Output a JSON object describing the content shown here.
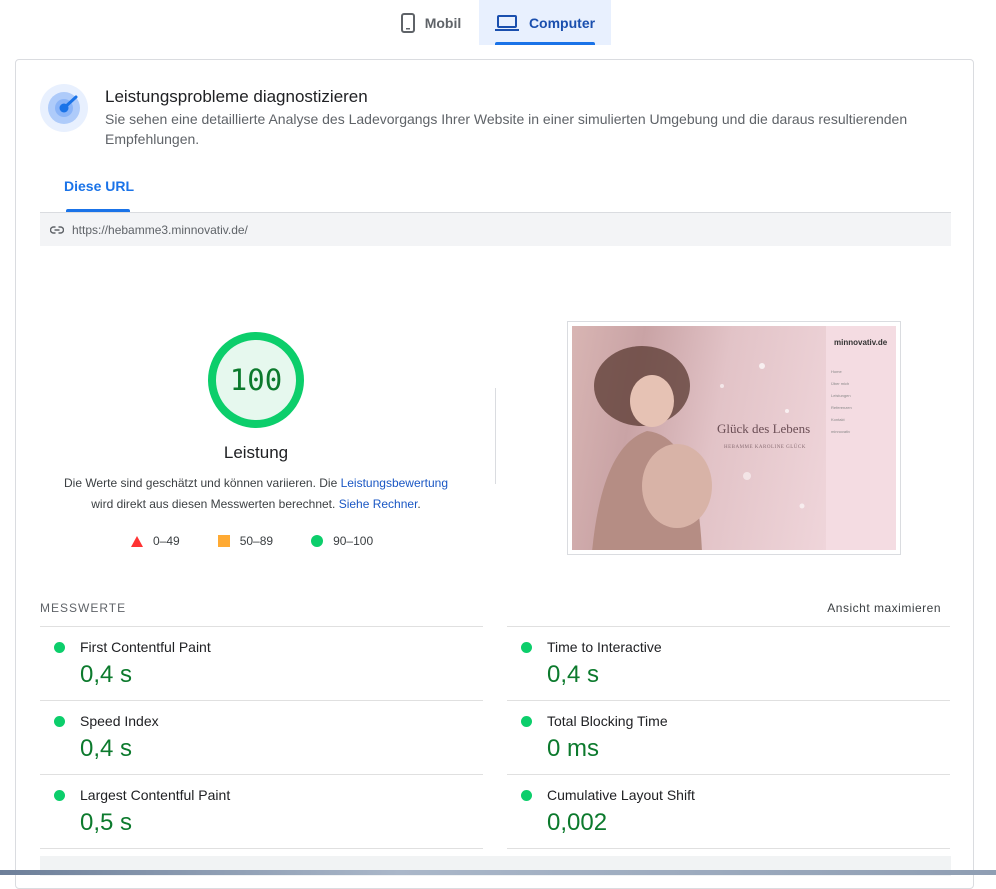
{
  "device_tabs": {
    "mobile": {
      "label": "Mobil",
      "icon": "smartphone-icon"
    },
    "computer": {
      "label": "Computer",
      "icon": "laptop-icon",
      "selected": true
    }
  },
  "diagnose": {
    "icon": "speed-gauge-icon",
    "title": "Leistungsprobleme diagnostizieren",
    "description": "Sie sehen eine detaillierte Analyse des Ladevorgangs Ihrer Website in einer simulierten Umgebung und die daraus resultierenden Empfehlungen."
  },
  "url_tab": {
    "label": "Diese URL"
  },
  "url_bar": {
    "icon": "link-icon",
    "url": "https://hebamme3.minnovativ.de/"
  },
  "score": {
    "value": "100",
    "fraction": 1.0,
    "label": "Leistung",
    "note_part1": "Die Werte sind geschätzt und können variieren. Die ",
    "note_link1": "Leistungsbewertung",
    "note_part2": "wird direkt aus diesen Messwerten berechnet. ",
    "note_link2": "Siehe Rechner",
    "note_end": ".",
    "color": "#0cce6b"
  },
  "legend": [
    {
      "range": "0–49",
      "shape": "triangle",
      "color": "#ff3333"
    },
    {
      "range": "50–89",
      "shape": "square",
      "color": "#ffaa33"
    },
    {
      "range": "90–100",
      "shape": "circle",
      "color": "#0cce6b"
    }
  ],
  "thumbnail": {
    "logo": "minnovativ.de",
    "nav": [
      "Home",
      "Über mich",
      "Leistungen",
      "Referenzen",
      "Kontakt",
      "minnovativ"
    ],
    "headline": "Glück des Lebens",
    "subline": "HEBAMME KAROLINE GLÜCK"
  },
  "metrics": {
    "title": "MESSWERTE",
    "toggle": "Ansicht maximieren",
    "items": [
      {
        "label": "First Contentful Paint",
        "value": "0,4 s"
      },
      {
        "label": "Time to Interactive",
        "value": "0,4 s"
      },
      {
        "label": "Speed Index",
        "value": "0,4 s"
      },
      {
        "label": "Total Blocking Time",
        "value": "0 ms"
      },
      {
        "label": "Largest Contentful Paint",
        "value": "0,5 s"
      },
      {
        "label": "Cumulative Layout Shift",
        "value": "0,002"
      }
    ],
    "good_color": "#0cce6b"
  }
}
